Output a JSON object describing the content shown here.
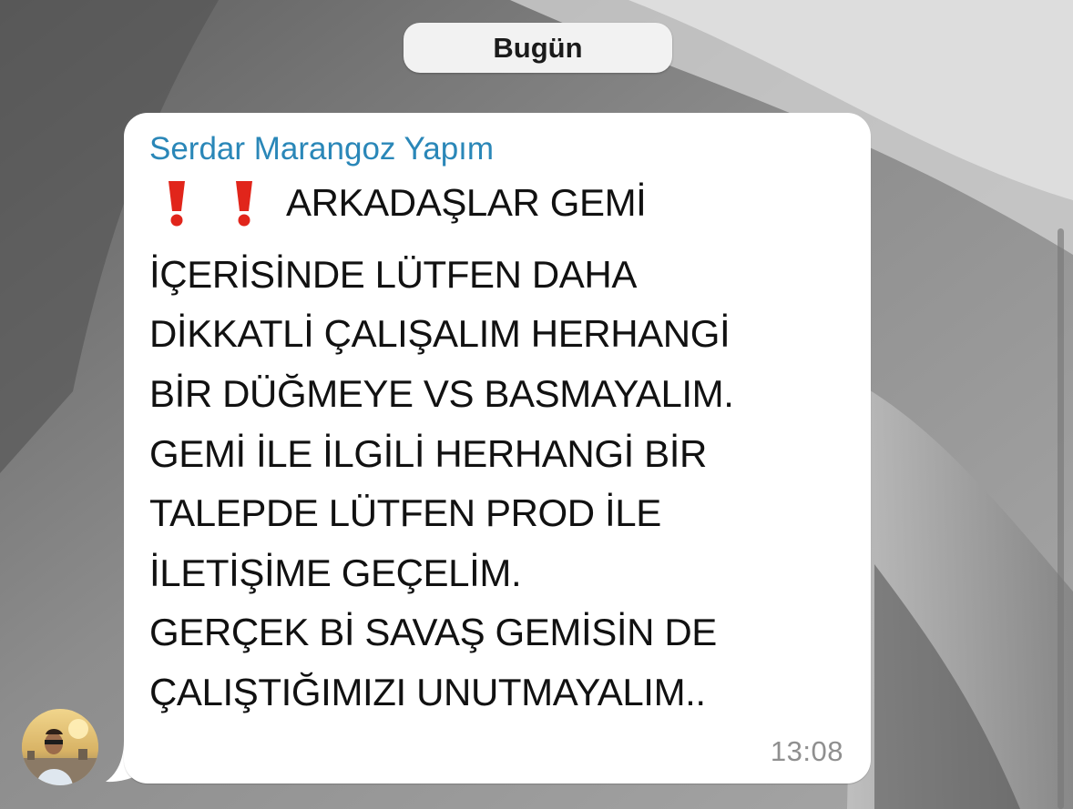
{
  "chat": {
    "date_label": "Bugün",
    "message": {
      "sender": "Serdar Marangoz Yapım",
      "emoji": [
        "❗",
        "❗"
      ],
      "lines": [
        "ARKADAŞLAR GEMİ",
        "İÇERİSİNDE LÜTFEN DAHA",
        "DİKKATLİ ÇALIŞALIM HERHANGİ",
        "BİR DÜĞMEYE VS BASMAYALIM.",
        "GEMİ İLE İLGİLİ HERHANGİ BİR",
        "TALEPDE LÜTFEN PROD İLE",
        "İLETİŞİME GEÇELİM.",
        "GERÇEK Bİ SAVAŞ GEMİSİN DE",
        "ÇALIŞTIĞIMIZI UNUTMAYALIM.."
      ],
      "time": "13:08"
    },
    "avatar_icon": "user-photo-icon"
  },
  "colors": {
    "sender_name": "#2a87b8",
    "bubble_bg": "#ffffff",
    "date_pill_bg": "#f2f2f2",
    "timestamp": "#8f8f8f",
    "exclamation": "#e1251b",
    "wallpaper": "#6f6f6f"
  }
}
